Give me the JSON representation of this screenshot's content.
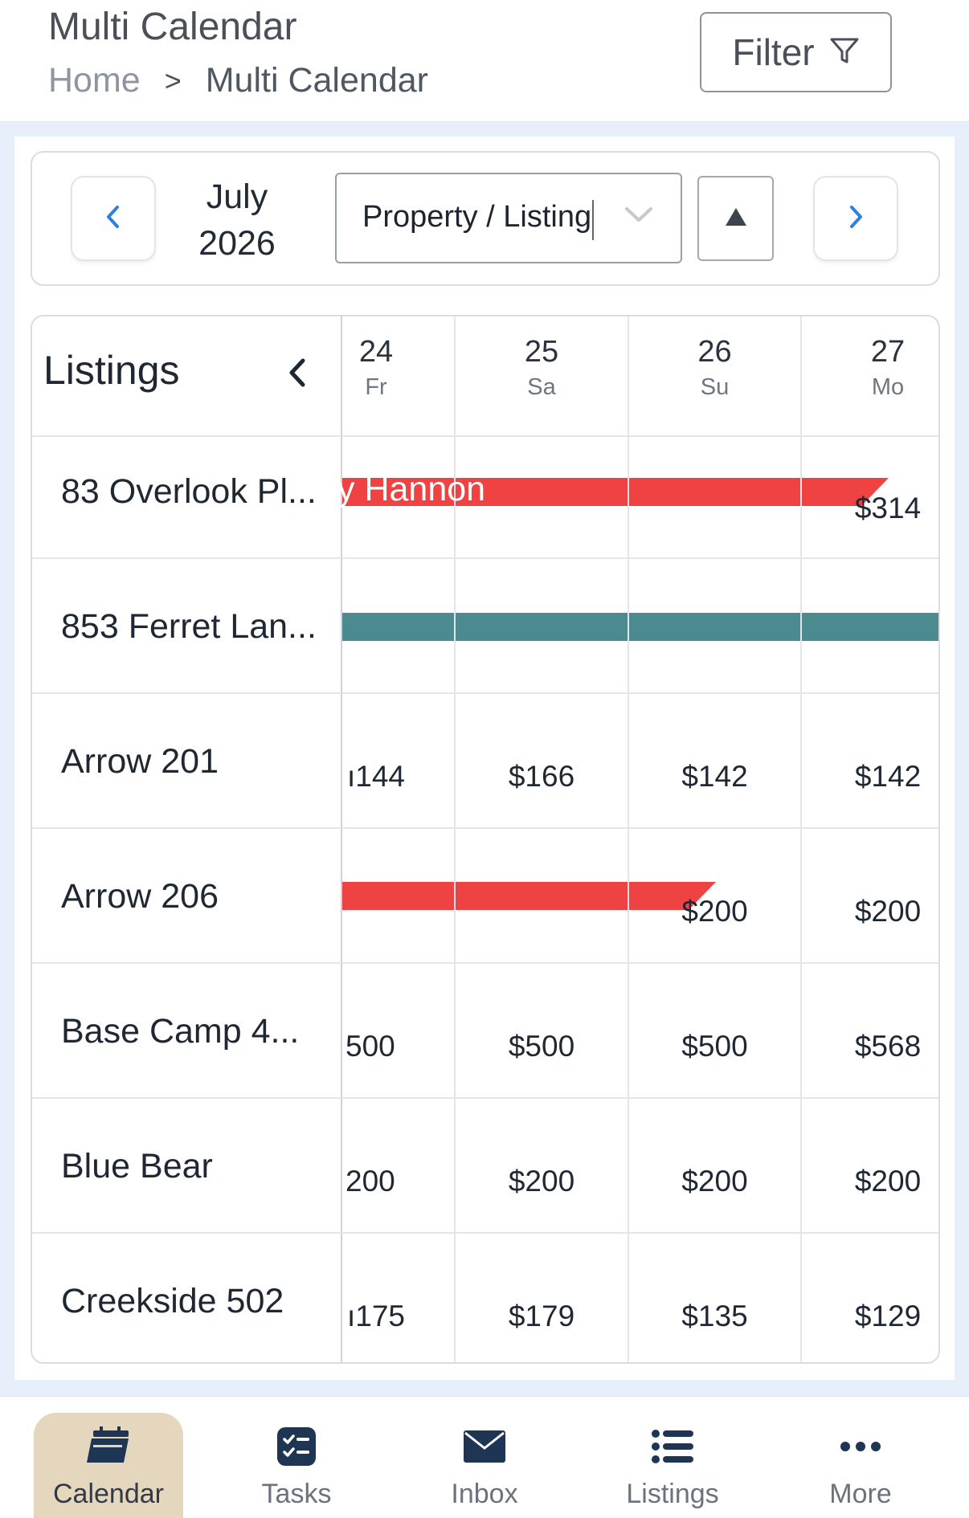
{
  "header": {
    "title": "Multi Calendar",
    "breadcrumb": {
      "home": "Home",
      "separator": ">",
      "current": "Multi Calendar"
    },
    "filter_label": "Filter",
    "filter_icon": "filter-funnel-icon"
  },
  "date_nav": {
    "month": "July",
    "year": "2026",
    "prev_icon": "chevron-left-icon",
    "next_icon": "chevron-right-icon",
    "property_select": "Property / Listing",
    "sort_icon": "triangle-up-icon"
  },
  "grid": {
    "listings_header": "Listings",
    "days": [
      {
        "num": "24",
        "weekday": "Fr"
      },
      {
        "num": "25",
        "weekday": "Sa"
      },
      {
        "num": "26",
        "weekday": "Su"
      },
      {
        "num": "27",
        "weekday": "Mo"
      }
    ],
    "rows": [
      {
        "name": "83 Overlook Pl...",
        "prices": [
          "",
          "",
          "",
          "$314"
        ],
        "reservation": {
          "guest": "y Hannon",
          "color": "#ee4243"
        }
      },
      {
        "name": "853 Ferret Lan...",
        "prices": [
          "",
          "",
          "",
          ""
        ],
        "reservation": {
          "guest": "",
          "color": "#4b8b8f"
        }
      },
      {
        "name": "Arrow 201",
        "prices": [
          "ı144",
          "$166",
          "$142",
          "$142"
        ]
      },
      {
        "name": "Arrow 206",
        "prices": [
          "",
          "",
          "$200",
          "$200"
        ],
        "reservation": {
          "guest": "",
          "color": "#ee4243"
        }
      },
      {
        "name": "Base Camp 4...",
        "prices": [
          "500",
          "$500",
          "$500",
          "$568"
        ]
      },
      {
        "name": "Blue Bear",
        "prices": [
          "200",
          "$200",
          "$200",
          "$200"
        ]
      },
      {
        "name": "Creekside 502",
        "prices": [
          "ı175",
          "$179",
          "$135",
          "$129"
        ]
      }
    ]
  },
  "bottom_nav": {
    "items": [
      {
        "label": "Calendar",
        "icon": "calendar-icon",
        "active": true
      },
      {
        "label": "Tasks",
        "icon": "tasks-checklist-icon"
      },
      {
        "label": "Inbox",
        "icon": "envelope-icon"
      },
      {
        "label": "Listings",
        "icon": "list-icon"
      },
      {
        "label": "More",
        "icon": "more-dots-icon"
      }
    ],
    "active_color": "#e5d7bd"
  }
}
